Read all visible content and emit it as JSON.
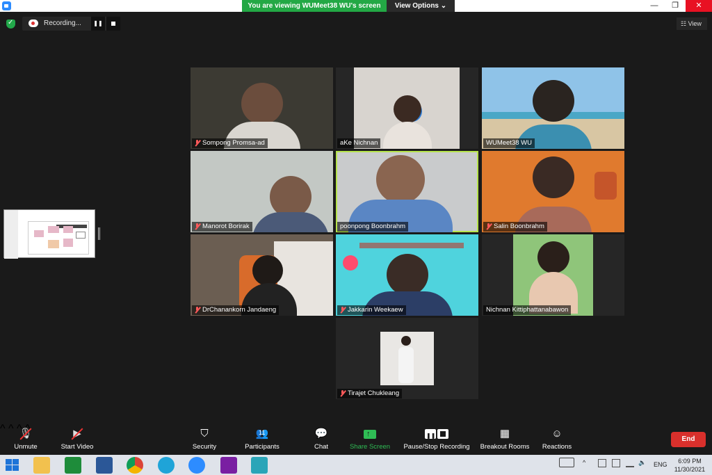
{
  "titlebar": {
    "banner": "You are viewing WUMeet38 WU's screen",
    "view_options": "View Options ⌄",
    "minimize": "—",
    "restore": "❐",
    "close": "✕"
  },
  "recording": {
    "label": "Recording...",
    "pause": "❚❚"
  },
  "view_button": "☷ View",
  "tiles": [
    {
      "name": "Sompong Promsa-ad",
      "muted": true
    },
    {
      "name": "aKe Nichnan",
      "muted": false
    },
    {
      "name": "WUMeet38 WU",
      "muted": false
    },
    {
      "name": "Manorot Borirak",
      "muted": true
    },
    {
      "name": "poonpong Boonbrahm",
      "muted": false,
      "active": true
    },
    {
      "name": "Salin Boonbrahm",
      "muted": true
    },
    {
      "name": "DrChanankorn Jandaeng",
      "muted": true
    },
    {
      "name": "Jakkarin Weekaew",
      "muted": true
    },
    {
      "name": "Nichnan Kittiphattanabawon",
      "muted": false
    },
    {
      "name": "Tirajet Chukleang",
      "muted": true
    }
  ],
  "toolbar": {
    "unmute": "Unmute",
    "start_video": "Start Video",
    "security": "Security",
    "participants": "Participants",
    "participants_count": "11",
    "chat": "Chat",
    "share_screen": "Share Screen",
    "pause_stop_recording": "Pause/Stop Recording",
    "breakout_rooms": "Breakout Rooms",
    "reactions": "Reactions",
    "end": "End",
    "caret": "^"
  },
  "taskbar": {
    "language": "ENG",
    "time": "6:09 PM",
    "date": "11/30/2021"
  },
  "colors": {
    "banner_green": "#23a845",
    "end_red": "#d9302c",
    "active_border": "#b5e34a",
    "share_green": "#2fbd55"
  }
}
